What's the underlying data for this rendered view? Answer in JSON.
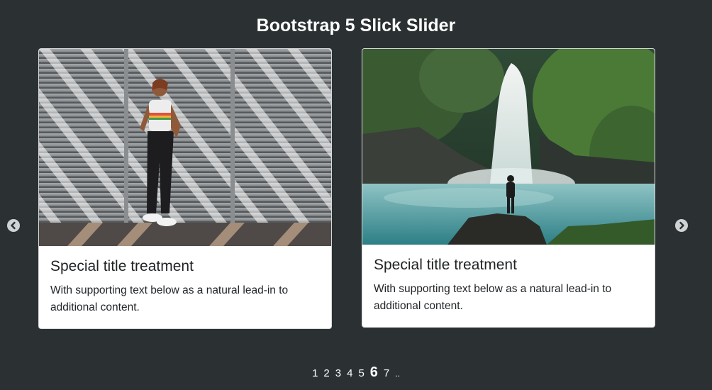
{
  "page": {
    "title": "Bootstrap 5 Slick Slider"
  },
  "slides": [
    {
      "image_alt": "woman-against-shutter-wall-photo",
      "title": "Special title treatment",
      "text": "With supporting text below as a natural lead-in to additional content."
    },
    {
      "image_alt": "waterfall-hiker-photo",
      "title": "Special title treatment",
      "text": "With supporting text below as a natural lead-in to additional content."
    }
  ],
  "pagination": {
    "dots": [
      "1",
      "2",
      "3",
      "4",
      "5",
      "6",
      "7",
      ".."
    ],
    "active": "6"
  },
  "colors": {
    "background": "#2b3133",
    "card": "#ffffff",
    "arrow": "#cfd3d4",
    "text": "#212529"
  }
}
